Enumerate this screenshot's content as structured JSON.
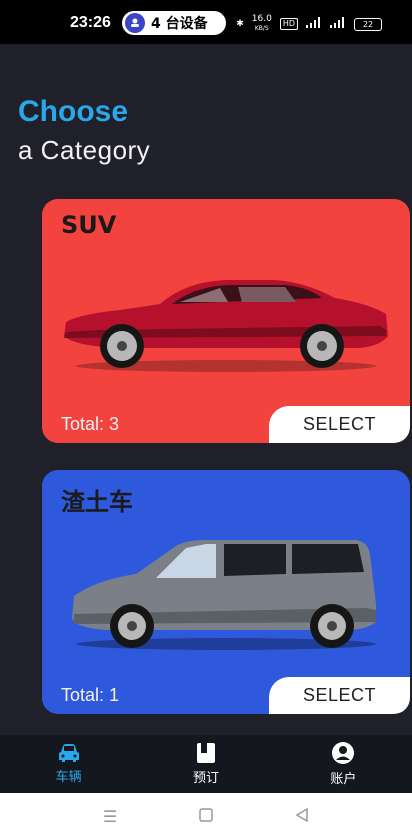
{
  "status_bar": {
    "time": "23:26",
    "devices": "4 台设备",
    "net_speed_top": "16.0",
    "net_speed_unit": "KB/S",
    "hd": "HD",
    "battery": "22"
  },
  "header": {
    "title": "Choose",
    "subtitle": "a Category"
  },
  "cards": [
    {
      "title": "SUV",
      "total": "Total: 3",
      "select": "SELECT",
      "color": "#f2433f"
    },
    {
      "title": "渣土车",
      "total": "Total: 1",
      "select": "SELECT",
      "color": "#2f59dc"
    }
  ],
  "bottom_nav": [
    {
      "label": "车辆",
      "icon": "car-icon",
      "active": true
    },
    {
      "label": "预订",
      "icon": "booking-icon",
      "active": false
    },
    {
      "label": "账户",
      "icon": "account-icon",
      "active": false
    }
  ],
  "colors": {
    "accent": "#2aa7e9",
    "background": "#1f2029"
  }
}
